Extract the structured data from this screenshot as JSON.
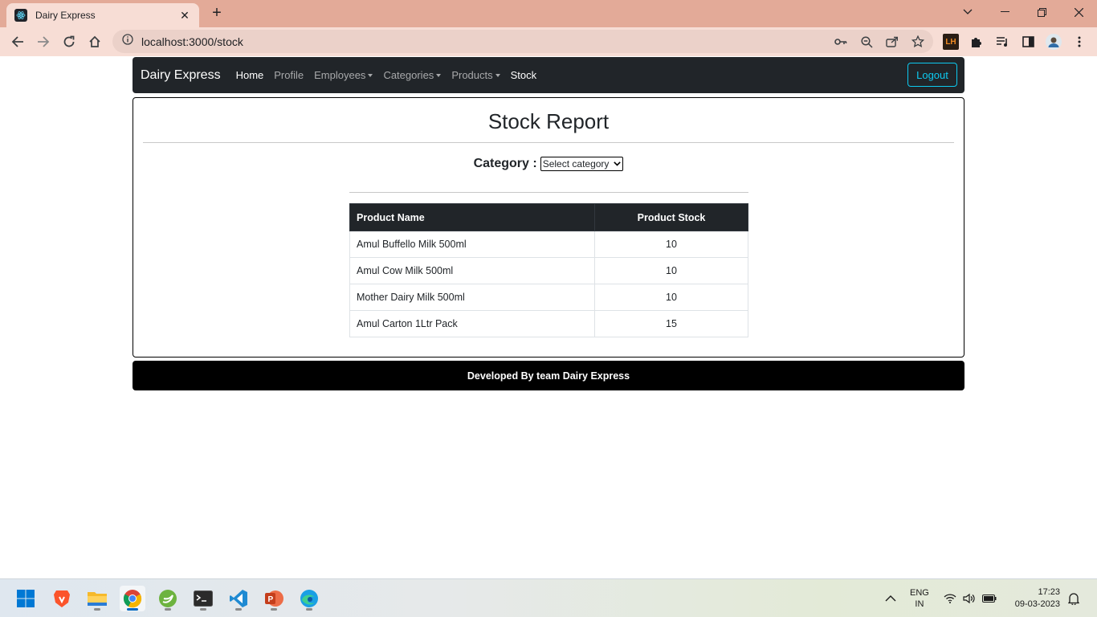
{
  "browser": {
    "tab_title": "Dairy Express",
    "url": "localhost:3000/stock",
    "extension_label": "LH"
  },
  "navbar": {
    "brand": "Dairy Express",
    "links": [
      {
        "label": "Home",
        "active": true,
        "dropdown": false
      },
      {
        "label": "Profile",
        "active": false,
        "dropdown": false
      },
      {
        "label": "Employees",
        "active": false,
        "dropdown": true
      },
      {
        "label": "Categories",
        "active": false,
        "dropdown": true
      },
      {
        "label": "Products",
        "active": false,
        "dropdown": true
      },
      {
        "label": "Stock",
        "active": false,
        "dropdown": false
      }
    ],
    "logout_label": "Logout"
  },
  "report": {
    "title": "Stock Report",
    "category_label": "Category :",
    "category_select_value": "Select category",
    "headers": [
      "Product Name",
      "Product Stock"
    ],
    "rows": [
      {
        "name": "Amul Buffello Milk 500ml",
        "stock": "10"
      },
      {
        "name": "Amul Cow Milk 500ml",
        "stock": "10"
      },
      {
        "name": "Mother Dairy Milk 500ml",
        "stock": "10"
      },
      {
        "name": "Amul Carton 1Ltr Pack",
        "stock": "15"
      }
    ]
  },
  "footer": {
    "text": "Developed By team Dairy Express"
  },
  "taskbar": {
    "lang_top": "ENG",
    "lang_bottom": "IN",
    "time": "17:23",
    "date": "09-03-2023"
  },
  "colors": {
    "tabstrip": "#e3aa98",
    "toolbar": "#f7ddd5",
    "navbar": "#212529",
    "logout_accent": "#0dcaf0",
    "footer": "#000000"
  }
}
